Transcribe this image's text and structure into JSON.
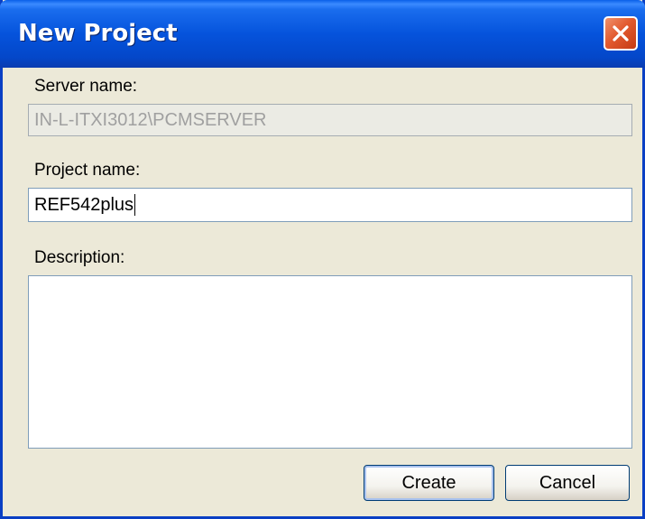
{
  "window": {
    "title": "New Project"
  },
  "server": {
    "label": "Server name:",
    "value": "IN-L-ITXI3012\\PCMSERVER"
  },
  "project": {
    "label": "Project name:",
    "value": "REF542plus"
  },
  "description": {
    "label": "Description:",
    "value": ""
  },
  "buttons": {
    "create": "Create",
    "cancel": "Cancel"
  },
  "icons": {
    "close": "close-icon"
  }
}
